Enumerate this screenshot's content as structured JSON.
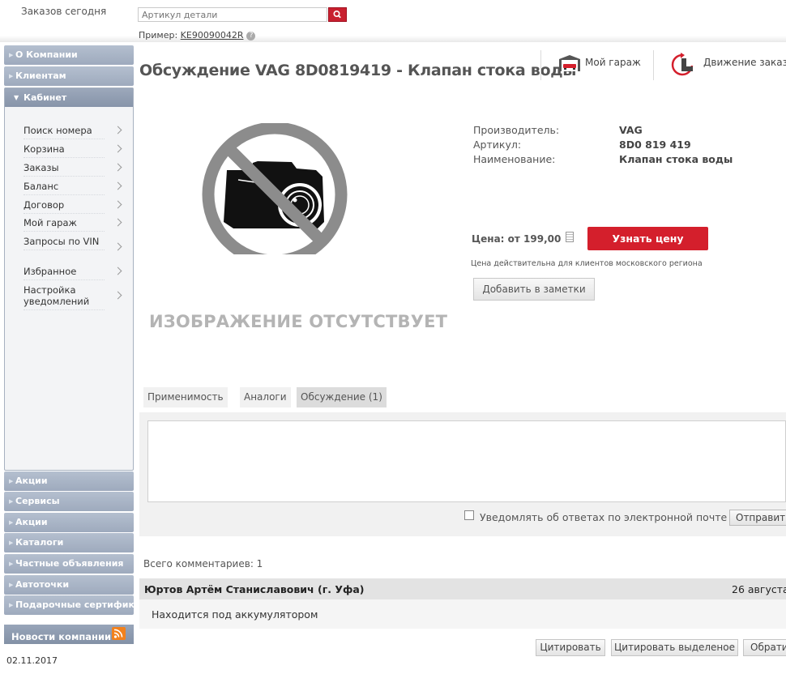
{
  "header": {
    "orders_today": "Заказов сегодня",
    "search_placeholder": "Артикул детали",
    "example_label": "Пример:",
    "example_value": "KE90090042R"
  },
  "sidebar": {
    "top_items": [
      {
        "label": "О Компании"
      },
      {
        "label": "Клиентам"
      }
    ],
    "cabinet": {
      "label": "Кабинет",
      "items": [
        {
          "label": "Поиск номера"
        },
        {
          "label": "Корзина"
        },
        {
          "label": "Заказы"
        },
        {
          "label": "Баланс"
        },
        {
          "label": "Договор"
        },
        {
          "label": "Мой гараж"
        },
        {
          "label": "Запросы по VIN"
        },
        {
          "label": "Избранное"
        },
        {
          "label": "Настройка уведомлений"
        }
      ]
    },
    "bottom_items": [
      {
        "label": "Акции"
      },
      {
        "label": "Сервисы"
      },
      {
        "label": "Акции"
      },
      {
        "label": "Каталоги"
      },
      {
        "label": "Частные объявления"
      },
      {
        "label": "Автоточки"
      },
      {
        "label": "Подарочные сертификаты"
      }
    ],
    "news": {
      "label": "Новости компании",
      "date": "02.11.2017"
    }
  },
  "page": {
    "title": "Обсуждение VAG 8D0819419 - Клапан стока воды",
    "garage_link": "Мой гараж",
    "orders_move_link": "Движение заказов",
    "no_image_text": "ИЗОБРАЖЕНИЕ ОТСУТСТВУЕТ"
  },
  "product": {
    "manufacturer_label": "Производитель:",
    "manufacturer": "VAG",
    "article_label": "Артикул:",
    "article": "8D0 819 419",
    "name_label": "Наименование:",
    "name": "Клапан стока воды",
    "price": "Цена: от 199,00",
    "price_button": "Узнать цену",
    "price_note": "Цена действительна для клиентов московского региона",
    "notes_button": "Добавить в заметки"
  },
  "tabs": [
    {
      "label": "Применимость"
    },
    {
      "label": "Аналоги"
    },
    {
      "label": "Обсуждение (1)"
    }
  ],
  "discussion": {
    "notify_label": "Уведомлять об ответах по электронной почте",
    "send_button": "Отправить",
    "total": "Всего комментариев: 1",
    "comment": {
      "author": "Юртов Артём Станиславович (г. Уфа)",
      "date": "26 августа",
      "text": "Находится под аккумулятором"
    },
    "quote_button": "Цитировать",
    "quote_selected_button": "Цитировать выделеное",
    "reply_button": "Обратиться"
  },
  "colors": {
    "accent_red": "#d41f2c",
    "nav_blue": "#a7b3c5"
  }
}
